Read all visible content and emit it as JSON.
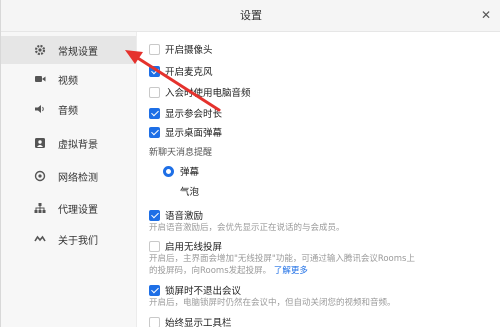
{
  "window": {
    "title": "设置",
    "close_glyph": "✕"
  },
  "sidebar": {
    "items": [
      {
        "label": "常规设置",
        "icon": "gear-icon"
      },
      {
        "label": "视频",
        "icon": "video-icon"
      },
      {
        "label": "音频",
        "icon": "speaker-icon"
      },
      {
        "label": "虚拟背景",
        "icon": "portrait-icon"
      },
      {
        "label": "网络检测",
        "icon": "network-icon"
      },
      {
        "label": "代理设置",
        "icon": "sitemap-icon"
      },
      {
        "label": "关于我们",
        "icon": "wave-icon"
      }
    ]
  },
  "settings": {
    "open_camera": {
      "label": "开启摄像头",
      "checked": false
    },
    "open_mic": {
      "label": "开启麦克风",
      "checked": true
    },
    "use_pc_audio": {
      "label": "入会时使用电脑音频",
      "checked": false
    },
    "show_duration": {
      "label": "显示参会时长",
      "checked": true
    },
    "show_desktop_popup": {
      "label": "显示桌面弹幕",
      "checked": true
    },
    "new_msg_heading": "新聊天消息提醒",
    "popup_option": {
      "label": "弹幕",
      "checked": true
    },
    "bubble_option": {
      "label": "气泡",
      "checked": false
    },
    "voice_excitation": {
      "label": "语音激励",
      "checked": true,
      "desc": "开启语音激励后，会优先显示正在说话的与会成员。"
    },
    "wireless_share": {
      "label": "启用无线投屏",
      "checked": false,
      "desc_1": "开启后，主界面会增加\"无线投屏\"功能，可通过输入腾讯会议Rooms上",
      "desc_2": "的投屏码，向Rooms发起投屏。",
      "link": "了解更多"
    },
    "keep_in_meeting": {
      "label": "锁屏时不退出会议",
      "checked": true,
      "desc": "开启后，电脑锁屏时仍然在会议中，但自动关闭您的视频和音频。"
    },
    "always_toolbar": {
      "label": "始终显示工具栏",
      "checked": false
    }
  },
  "colors": {
    "accent": "#1e6fe6",
    "arrow": "#e5322d"
  }
}
